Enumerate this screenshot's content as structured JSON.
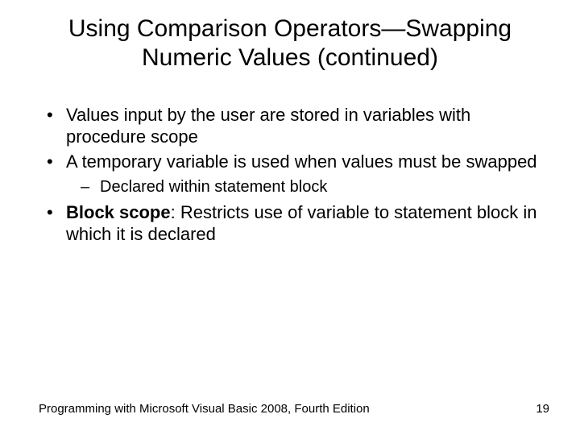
{
  "title": "Using Comparison Operators—Swapping Numeric Values (continued)",
  "bullets": {
    "b1": "Values input by the user are stored in variables with procedure scope",
    "b2": "A temporary variable is used when values must be swapped",
    "b2_sub1": "Declared within statement block",
    "b3_bold": "Block scope",
    "b3_rest": ": Restricts use of variable to statement block in which it is declared"
  },
  "footer": {
    "text": "Programming with Microsoft Visual Basic 2008, Fourth Edition",
    "page": "19"
  }
}
